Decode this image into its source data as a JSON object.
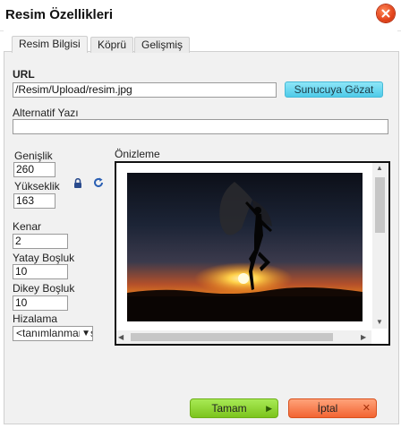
{
  "dialog": {
    "title": "Resim Özellikleri",
    "close_icon": "close-icon"
  },
  "tabs": [
    {
      "label": "Resim Bilgisi",
      "active": true
    },
    {
      "label": "Köprü",
      "active": false
    },
    {
      "label": "Gelişmiş",
      "active": false
    }
  ],
  "url": {
    "label": "URL",
    "value": "/Resim/Upload/resim.jpg",
    "browse_label": "Sunucuya Gözat"
  },
  "alt": {
    "label": "Alternatif Yazı",
    "value": ""
  },
  "width": {
    "label": "Genişlik",
    "value": "260"
  },
  "height": {
    "label": "Yükseklik",
    "value": "163"
  },
  "lock_icon": "lock-icon",
  "reset_icon": "reset-size-icon",
  "border": {
    "label": "Kenar",
    "value": "2"
  },
  "hspace": {
    "label": "Yatay Boşluk",
    "value": "10"
  },
  "vspace": {
    "label": "Dikey Boşluk",
    "value": "10"
  },
  "align": {
    "label": "Hizalama",
    "value": "<tanımlanmamış>"
  },
  "preview": {
    "label": "Önizleme"
  },
  "footer": {
    "ok_label": "Tamam",
    "cancel_label": "İptal"
  },
  "colors": {
    "ok": "#7cc41d",
    "cancel": "#f26432",
    "browse": "#4fcbe9",
    "close": "#e3431a"
  }
}
